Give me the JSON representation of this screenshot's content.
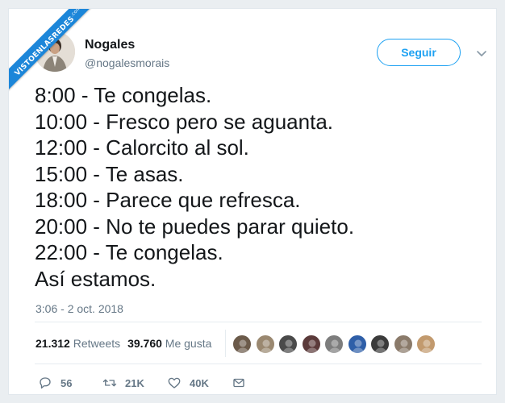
{
  "watermark": {
    "text": "VISTOENLASREDES",
    "suffix": ".com"
  },
  "user": {
    "display_name": "Nogales",
    "handle": "@nogalesmorais"
  },
  "follow_label": "Seguir",
  "tweet_lines": [
    "8:00 - Te congelas.",
    "10:00 - Fresco pero se aguanta.",
    "12:00 - Calorcito al sol.",
    "15:00 - Te asas.",
    "18:00 - Parece que refresca.",
    "20:00 - No te puedes parar quieto.",
    "22:00 - Te congelas.",
    "Así estamos."
  ],
  "timestamp": "3:06 - 2 oct. 2018",
  "stats": {
    "retweets_count": "21.312",
    "retweets_label": "Retweets",
    "likes_count": "39.760",
    "likes_label": "Me gusta"
  },
  "liker_avatars": [
    {
      "name": "liker-avatar",
      "color": "#6b5a4a"
    },
    {
      "name": "liker-avatar",
      "color": "#9a8870"
    },
    {
      "name": "liker-avatar",
      "color": "#4a4a4a"
    },
    {
      "name": "liker-avatar",
      "color": "#5b3a3a"
    },
    {
      "name": "liker-avatar",
      "color": "#7d7d7d"
    },
    {
      "name": "liker-avatar",
      "color": "#2f5fa8"
    },
    {
      "name": "liker-avatar",
      "color": "#3b3b3b"
    },
    {
      "name": "liker-avatar",
      "color": "#8a7a6a"
    },
    {
      "name": "liker-avatar",
      "color": "#c29a6e"
    }
  ],
  "actions": {
    "replies": "56",
    "retweets": "21K",
    "likes": "40K"
  },
  "colors": {
    "accent": "#1da1f2",
    "text": "#14171a",
    "muted": "#657786",
    "watermark": "#1c86d9"
  }
}
